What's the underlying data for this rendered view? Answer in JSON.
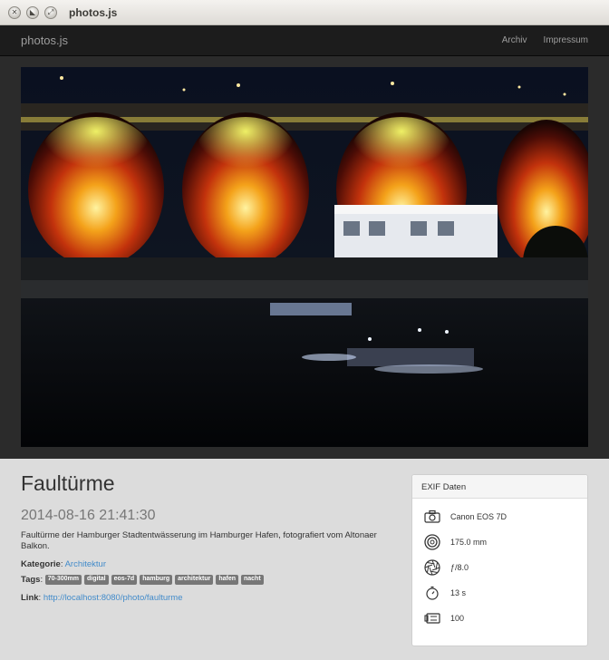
{
  "window": {
    "title": "photos.js"
  },
  "navbar": {
    "brand": "photos.js",
    "links": [
      {
        "label": "Archiv"
      },
      {
        "label": "Impressum"
      }
    ]
  },
  "photo": {
    "title": "Faultürme",
    "datetime": "2014-08-16 21:41:30",
    "description": "Faultürme der Hamburger Stadtentwässerung im Hamburger Hafen, fotografiert vom Altonaer Balkon.",
    "category_label": "Kategorie",
    "category": "Architektur",
    "tags_label": "Tags",
    "tags": [
      "70-300mm",
      "digital",
      "eos-7d",
      "hamburg",
      "architektur",
      "hafen",
      "nacht"
    ],
    "link_label": "Link",
    "link": "http://localhost:8080/photo/faulturme"
  },
  "exif": {
    "heading": "EXIF Daten",
    "camera": "Canon EOS 7D",
    "focal_length": "175.0 mm",
    "aperture": "ƒ/8.0",
    "exposure": "13 s",
    "iso": "100"
  }
}
